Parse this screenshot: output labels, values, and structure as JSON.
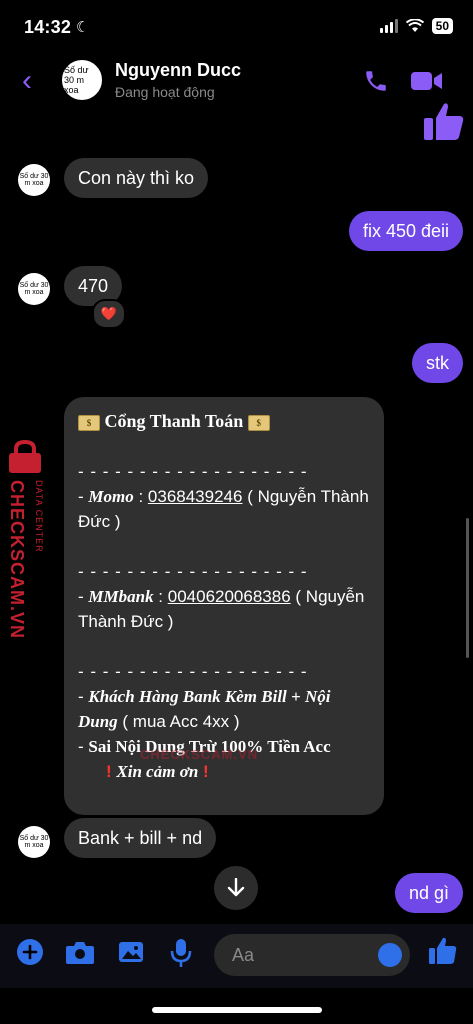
{
  "status_bar": {
    "time": "14:32",
    "battery": "50"
  },
  "header": {
    "contact_name": "Nguyenn Ducc",
    "contact_status": "Đang hoạt động",
    "avatar_text": "Số dư 30 m xoa"
  },
  "messages": [
    {
      "side": "in",
      "text": "Con này thì ko"
    },
    {
      "side": "out",
      "text": "fix 450 đeii"
    },
    {
      "side": "in",
      "text": "470",
      "reaction": "❤️"
    },
    {
      "side": "out",
      "text": "stk"
    },
    {
      "side": "in",
      "text": "Bank + bill + nd"
    },
    {
      "side": "out",
      "text": "nd gì"
    }
  ],
  "payment_card": {
    "title": "Cổng Thanh Toán",
    "divider": "- - - - - - - - - - - - - - - - - - -",
    "momo_label": "Momo",
    "momo_number": "0368439246",
    "momo_owner": "( Nguyễn Thành Đức )",
    "mmbank_label": "MMbank",
    "mmbank_number": "0040620068386",
    "mmbank_owner": "( Nguyễn Thành Đức )",
    "note1_bold": "Khách Hàng Bank Kèm Bill + Nội Dung",
    "note1_rest": "( mua Acc 4xx )",
    "note2": "Sai Nội Dung Trừ  100% Tiền Acc",
    "thanks": "Xin cảm ơn"
  },
  "watermark": {
    "side_text": "CHECKSCAM.VN",
    "side_sub": "DATA CENTER",
    "mid_text": "CHECKSCAM.VN"
  },
  "composer": {
    "placeholder": "Aa"
  },
  "colors": {
    "accent": "#8b5cf6",
    "outgoing": "#7048e8",
    "incoming": "#303030",
    "watermark": "#c42030"
  }
}
